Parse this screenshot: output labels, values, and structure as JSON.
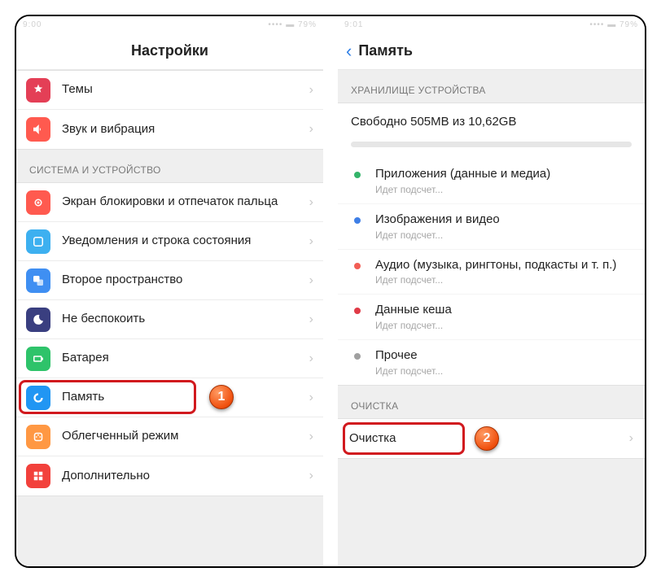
{
  "left": {
    "status_time": "9:00",
    "status_right": "•••• ▬ 79%",
    "title": "Настройки",
    "group1": [
      {
        "label": "Темы"
      },
      {
        "label": "Звук и вибрация"
      }
    ],
    "section_system": "СИСТЕМА И УСТРОЙСТВО",
    "group2": [
      {
        "label": "Экран блокировки и отпечаток пальца"
      },
      {
        "label": "Уведомления и строка состояния"
      },
      {
        "label": "Второе пространство"
      },
      {
        "label": "Не беспокоить"
      },
      {
        "label": "Батарея"
      },
      {
        "label": "Память"
      },
      {
        "label": "Облегченный режим"
      },
      {
        "label": "Дополнительно"
      }
    ],
    "badge1": "1"
  },
  "right": {
    "status_time": "9:01",
    "status_right": "•••• ▬ 79%",
    "title": "Память",
    "section_storage": "ХРАНИЛИЩЕ УСТРОЙСТВА",
    "free_text": "Свободно 505MB из 10,62GB",
    "categories": [
      {
        "name": "Приложения (данные и медиа)",
        "sub": "Идет подсчет...",
        "color": "#34b46a"
      },
      {
        "name": "Изображения и видео",
        "sub": "Идет подсчет...",
        "color": "#3f7fe6"
      },
      {
        "name": "Аудио (музыка, рингтоны, подкасты и т. п.)",
        "sub": "Идет подсчет...",
        "color": "#f25e55"
      },
      {
        "name": "Данные кеша",
        "sub": "Идет подсчет...",
        "color": "#e03b47"
      },
      {
        "name": "Прочее",
        "sub": "Идет подсчет...",
        "color": "#a0a0a0"
      }
    ],
    "section_clean": "ОЧИСТКА",
    "clean_label": "Очистка",
    "badge2": "2"
  }
}
